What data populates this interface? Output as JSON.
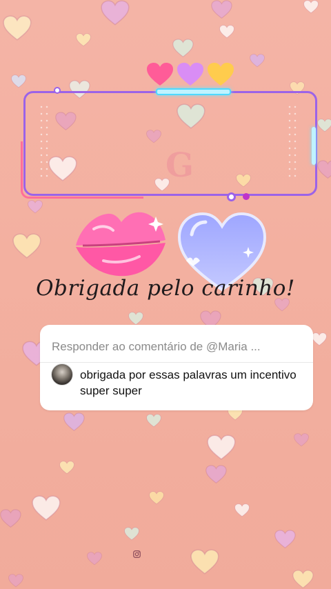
{
  "overlay": {
    "watermark_letter": "G",
    "thank_you_text": "Obrigada pelo carinho!"
  },
  "reply_card": {
    "header": "Responder ao comentário de @Maria ...",
    "comment_text": "obrigada por essas palavras um incentivo super super"
  },
  "colors": {
    "background": "#f3b0a0",
    "frame_border": "#9b63e8",
    "frame_accent": "#ff6e9a",
    "frame_glow": "#4fd9ff",
    "lips": "#ff5ca8",
    "big_heart": "#a9b2ff",
    "card_bg": "#ffffff"
  },
  "icons": {
    "top_hearts": [
      "pink-heart-icon",
      "violet-heart-icon",
      "yellow-heart-icon"
    ],
    "decorations": [
      "kiss-lips-icon",
      "blue-heart-icon",
      "instagram-icon"
    ]
  }
}
